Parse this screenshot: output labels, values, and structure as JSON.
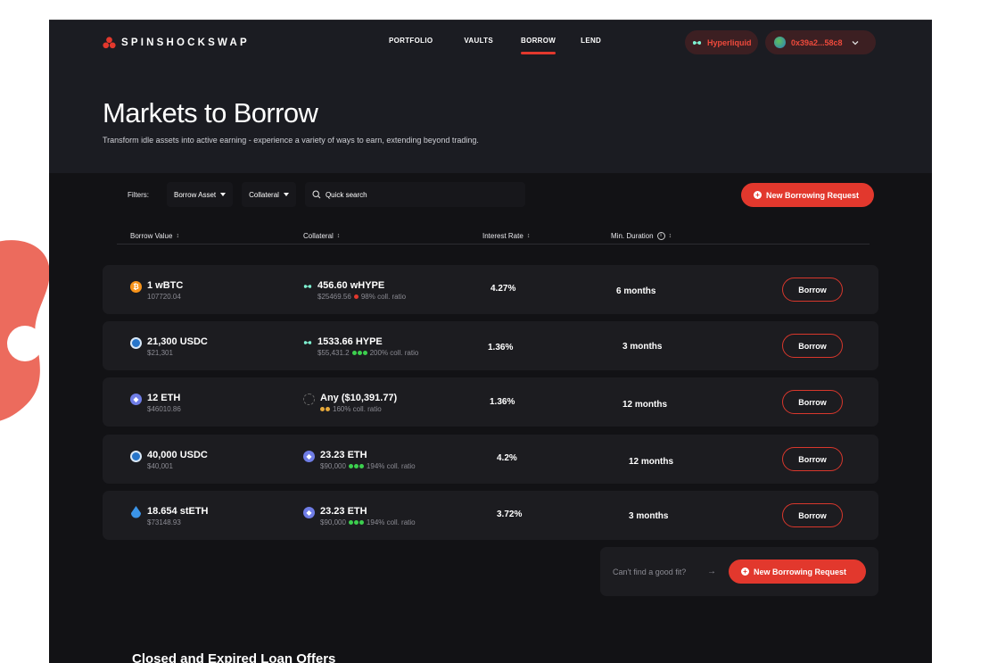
{
  "brand": {
    "name": "SPINSHOCKSWAP",
    "color": "#e2382d"
  },
  "nav": [
    {
      "label": "PORTFOLIO",
      "active": false
    },
    {
      "label": "VAULTS",
      "active": false
    },
    {
      "label": "BORROW",
      "active": true
    },
    {
      "label": "LEND",
      "active": false
    }
  ],
  "chain": {
    "label": "Hyperliquid",
    "icon": "hyperliquid-icon"
  },
  "wallet": {
    "address": "0x39a2...58c8",
    "icon": "globe-avatar-icon"
  },
  "page": {
    "title": "Markets to Borrow",
    "subtitle": "Transform idle assets into active earning - experience a variety of ways to earn, extending beyond trading."
  },
  "filters": {
    "label": "Filters:",
    "borrow_asset": "Borrow Asset",
    "collateral": "Collateral",
    "search_placeholder": "Quick search"
  },
  "new_request_label": "New Borrowing Request",
  "table": {
    "headers": [
      "Borrow Value",
      "Collateral",
      "Interest Rate",
      "Min. Duration"
    ],
    "rows": [
      {
        "borrow_amount": "1 wBTC",
        "borrow_value": "107720.04",
        "borrow_icon": "bitcoin-icon",
        "collateral_amount": "456.60 wHYPE",
        "collateral_value": "$25469.56",
        "coll_ratio": "98% coll. ratio",
        "collateral_icon": "hype-icon",
        "rate": "4.27%",
        "duration": "6 months",
        "action": "Borrow"
      },
      {
        "borrow_amount": "21,300 USDC",
        "borrow_value": "$21,301",
        "borrow_icon": "usdc-icon",
        "collateral_amount": "1533.66 HYPE",
        "collateral_value": "$55,431.2",
        "coll_ratio": "200% coll. ratio",
        "collateral_icon": "hype-icon",
        "rate": "1.36%",
        "duration": "3 months",
        "action": "Borrow"
      },
      {
        "borrow_amount": "12 ETH",
        "borrow_value": "$46010.86",
        "borrow_icon": "ethereum-icon",
        "collateral_amount": "Any ($10,391.77)",
        "collateral_value": "",
        "coll_ratio": "160% coll. ratio",
        "collateral_icon": "any-asset-icon",
        "rate": "1.36%",
        "duration": "12 months",
        "action": "Borrow"
      },
      {
        "borrow_amount": "40,000 USDC",
        "borrow_value": "$40,001",
        "borrow_icon": "usdc-icon",
        "collateral_amount": "23.23 ETH",
        "collateral_value": "$90,000",
        "coll_ratio": "194% coll. ratio",
        "collateral_icon": "ethereum-icon",
        "rate": "4.2%",
        "duration": "12 months",
        "action": "Borrow"
      },
      {
        "borrow_amount": "18.654 stETH",
        "borrow_value": "$73148.93",
        "borrow_icon": "steth-icon",
        "collateral_amount": "23.23 ETH",
        "collateral_value": "$90,000",
        "coll_ratio": "194% coll. ratio",
        "collateral_icon": "ethereum-icon",
        "rate": "3.72%",
        "duration": "3 months",
        "action": "Borrow"
      }
    ]
  },
  "fit_prompt": "Can't find a good fit?",
  "closed_section_title": "Closed and Expired Loan Offers"
}
